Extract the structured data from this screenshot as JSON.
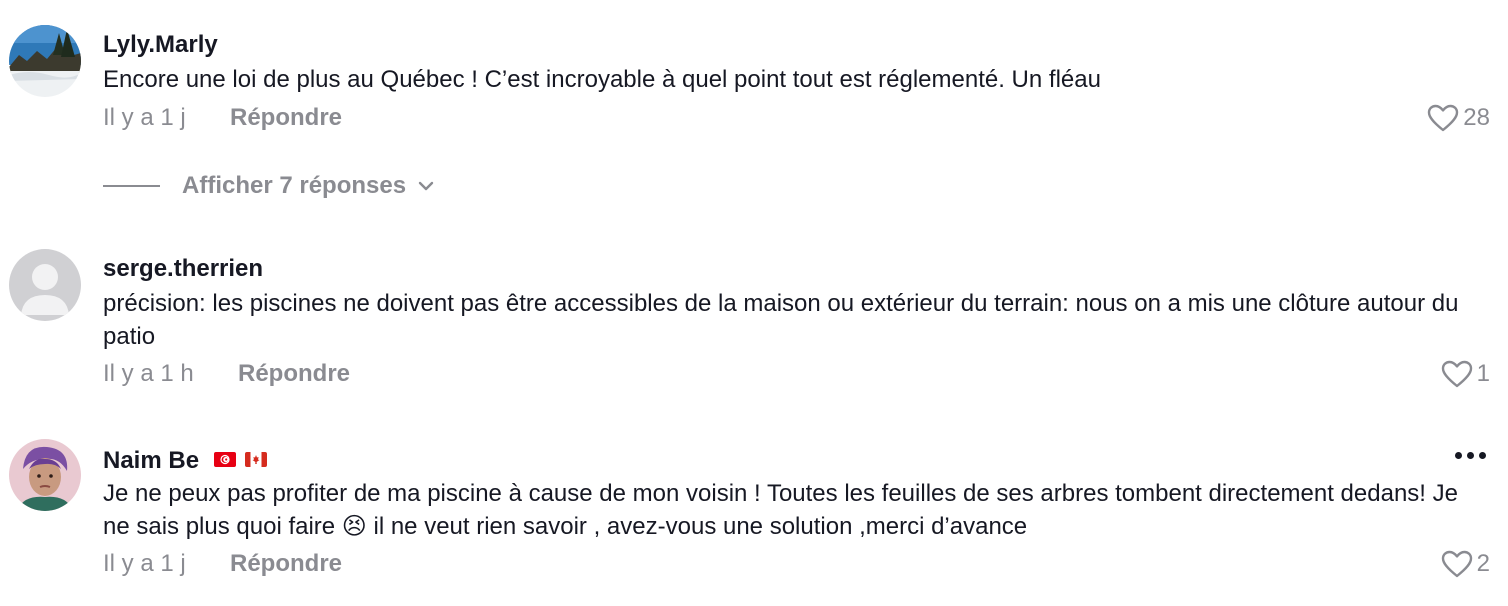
{
  "comments": [
    {
      "username": "Lyly.Marly",
      "text": "Encore une loi de plus au Québec ! C’est incroyable à quel point tout est réglementé. Un fléau",
      "time": "Il y a 1 j",
      "reply_label": "Répondre",
      "likes": "28",
      "view_replies": "Afficher 7 réponses"
    },
    {
      "username": "serge.therrien",
      "text": "précision: les piscines ne doivent pas être accessibles de la maison ou extérieur du terrain: nous on a mis une clôture autour du patio",
      "time": "Il y a 1 h",
      "reply_label": "Répondre",
      "likes": "1"
    },
    {
      "username": "Naim Be",
      "flags": [
        "tunisia-flag",
        "canada-flag"
      ],
      "text": "Je ne peux pas profiter de ma piscine à cause de mon voisin ! Toutes les feuilles de ses arbres tombent directement dedans! Je ne sais plus quoi faire 😣 il ne veut rien savoir , avez-vous une solution ,merci d’avance",
      "time": "Il y a 1 j",
      "reply_label": "Répondre",
      "likes": "2"
    }
  ],
  "icons": {
    "like": "heart-outline-icon",
    "expand": "chevron-down-icon",
    "more": "more-options-icon"
  },
  "colors": {
    "primary_text": "#161823",
    "secondary_text": "#8a8b91"
  }
}
